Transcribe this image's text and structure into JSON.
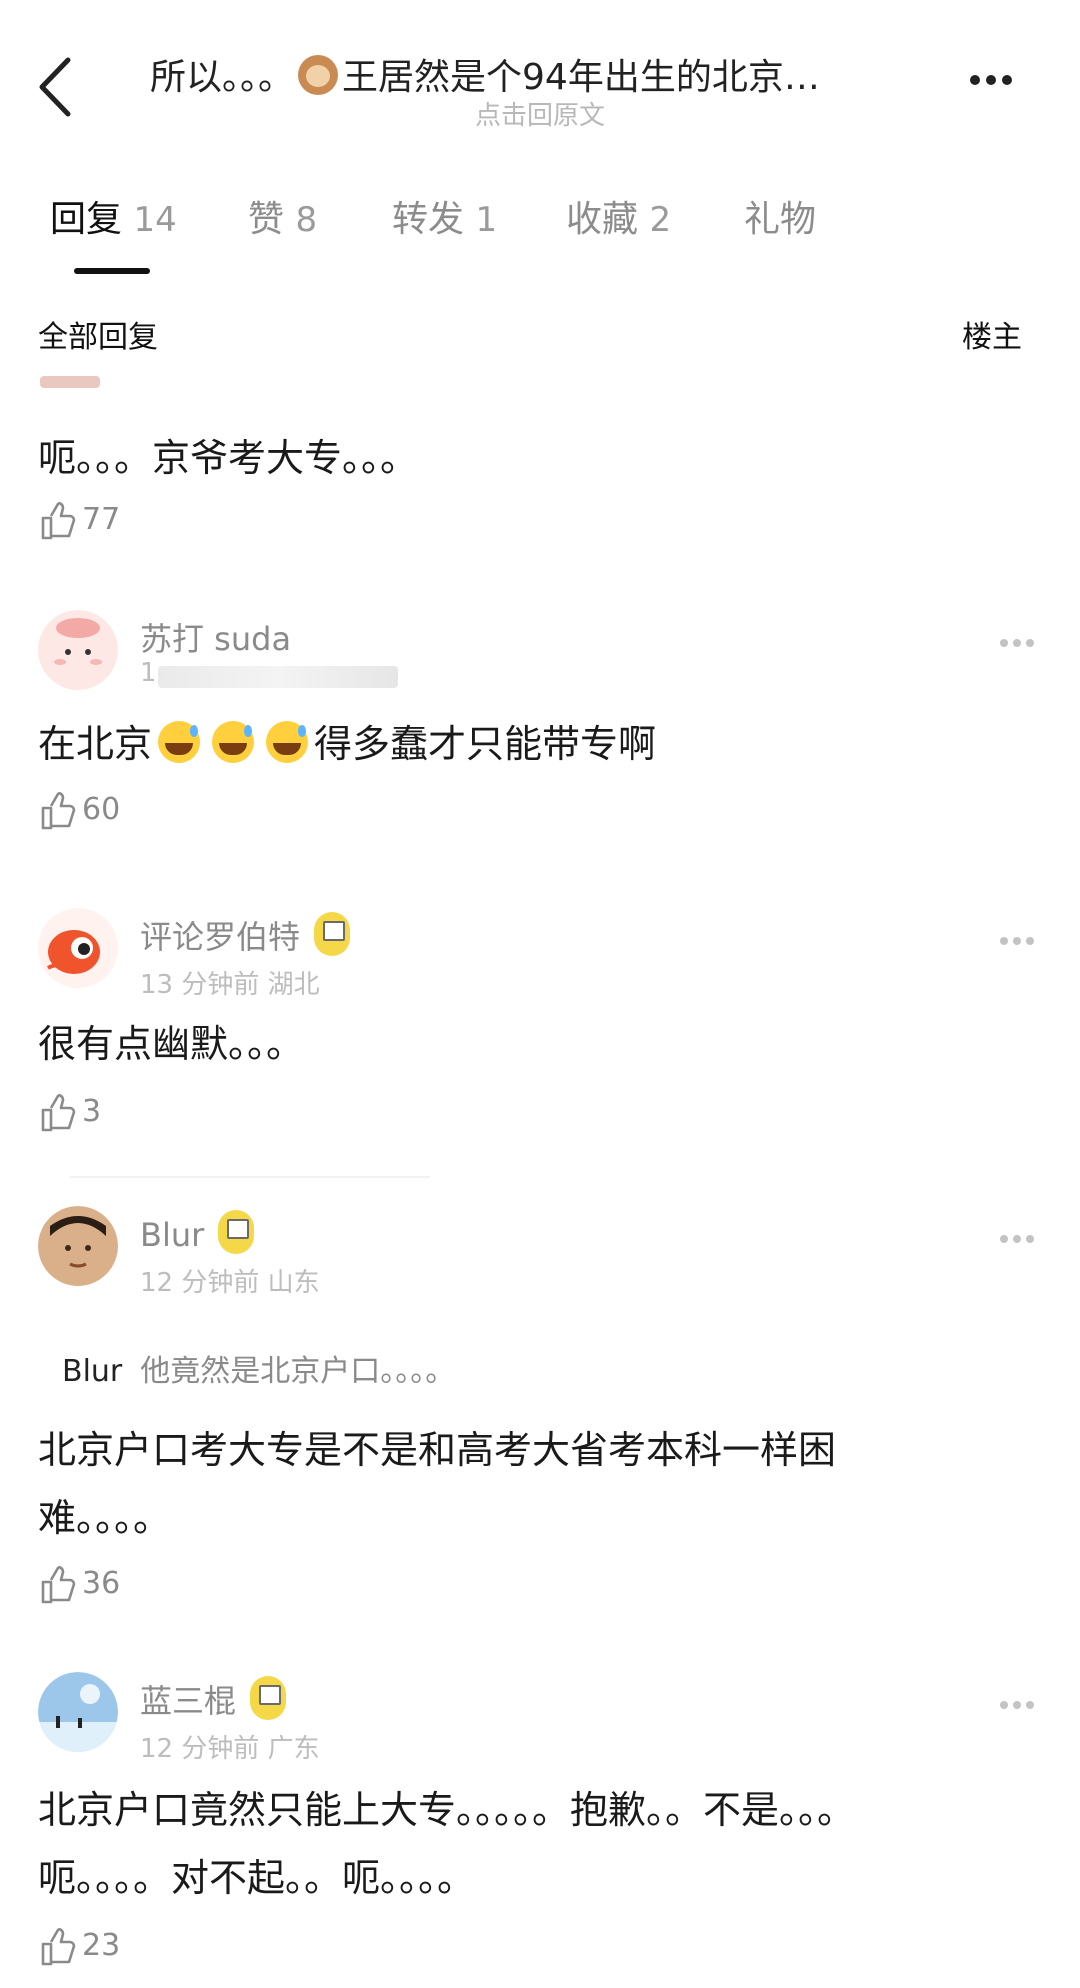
{
  "header": {
    "title": "所以。。。",
    "title_rest": "王居然是个94年出生的北京…",
    "subtitle": "点击回原文"
  },
  "tabs": [
    {
      "label": "回复",
      "count": "14"
    },
    {
      "label": "赞",
      "count": "8"
    },
    {
      "label": "转发",
      "count": "1"
    },
    {
      "label": "收藏",
      "count": "2"
    },
    {
      "label": "礼物",
      "count": ""
    }
  ],
  "section": {
    "left": "全部回复",
    "right": "楼主"
  },
  "comments": [
    {
      "text": "呃。。。京爷考大专。。。",
      "likes": "77"
    },
    {
      "username": "苏打 suda",
      "meta": "1",
      "text_pre": "在北京",
      "text_post": "得多蠢才只能带专啊",
      "likes": "60"
    },
    {
      "username": "评论罗伯特",
      "meta": "13 分钟前  湖北",
      "text": "很有点幽默。。。",
      "likes": "3"
    },
    {
      "username": "Blur",
      "meta": "12 分钟前  山东",
      "quote_user": "Blur",
      "quote_text": "他竟然是北京户口。。。。",
      "text": "北京户口考大专是不是和高考大省考本科一样困难。。。。",
      "likes": "36"
    },
    {
      "username": "蓝三棍",
      "meta": "12 分钟前  广东",
      "text": "北京户口竟然只能上大专。。。。。抱歉。。不是。。。呃。。。。对不起。。呃。。。。",
      "likes": "23"
    }
  ],
  "colors": {
    "badge": "#f5d848",
    "accent": "#111111",
    "muted": "#8a8a8a"
  }
}
